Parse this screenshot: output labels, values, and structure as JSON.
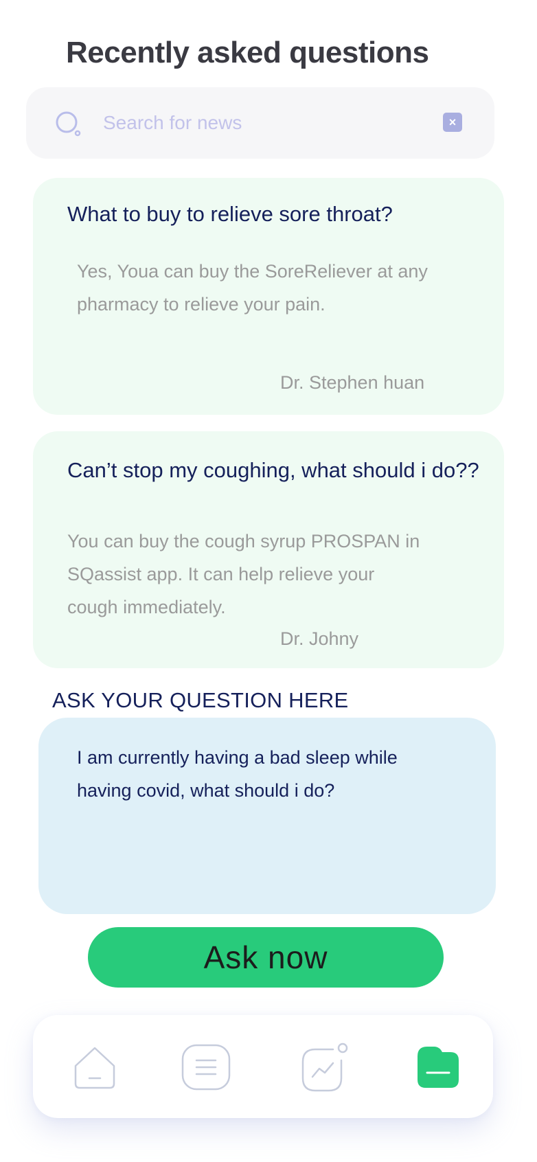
{
  "page": {
    "title": "Recently asked questions"
  },
  "search": {
    "placeholder": "Search for news",
    "value": ""
  },
  "questions": [
    {
      "title": "What to buy to relieve sore throat?",
      "answer": "Yes,  Youa can buy the SoreReliever at any pharmacy to relieve your pain.",
      "doctor": "Dr. Stephen huan"
    },
    {
      "title": "Can’t stop my coughing, what should i do??",
      "answer": "You can buy the cough syrup PROSPAN in SQassist app. It can help relieve your cough immediately.",
      "doctor": "Dr. Johny"
    }
  ],
  "ask": {
    "label": "ASK YOUR QUESTION HERE",
    "text": "I am currently having a bad sleep while having covid, what should i do?",
    "button_label": "Ask now"
  },
  "nav": {
    "items": [
      {
        "icon": "home-icon",
        "active": false
      },
      {
        "icon": "document-icon",
        "active": false
      },
      {
        "icon": "chart-icon",
        "active": false
      },
      {
        "icon": "folder-icon",
        "active": true
      }
    ]
  },
  "colors": {
    "card_bg": "#effbf3",
    "ask_box_bg": "#dff0f8",
    "accent_green": "#28cb7b",
    "title_navy": "#15205a",
    "icon_inactive": "#c6ccdc"
  }
}
